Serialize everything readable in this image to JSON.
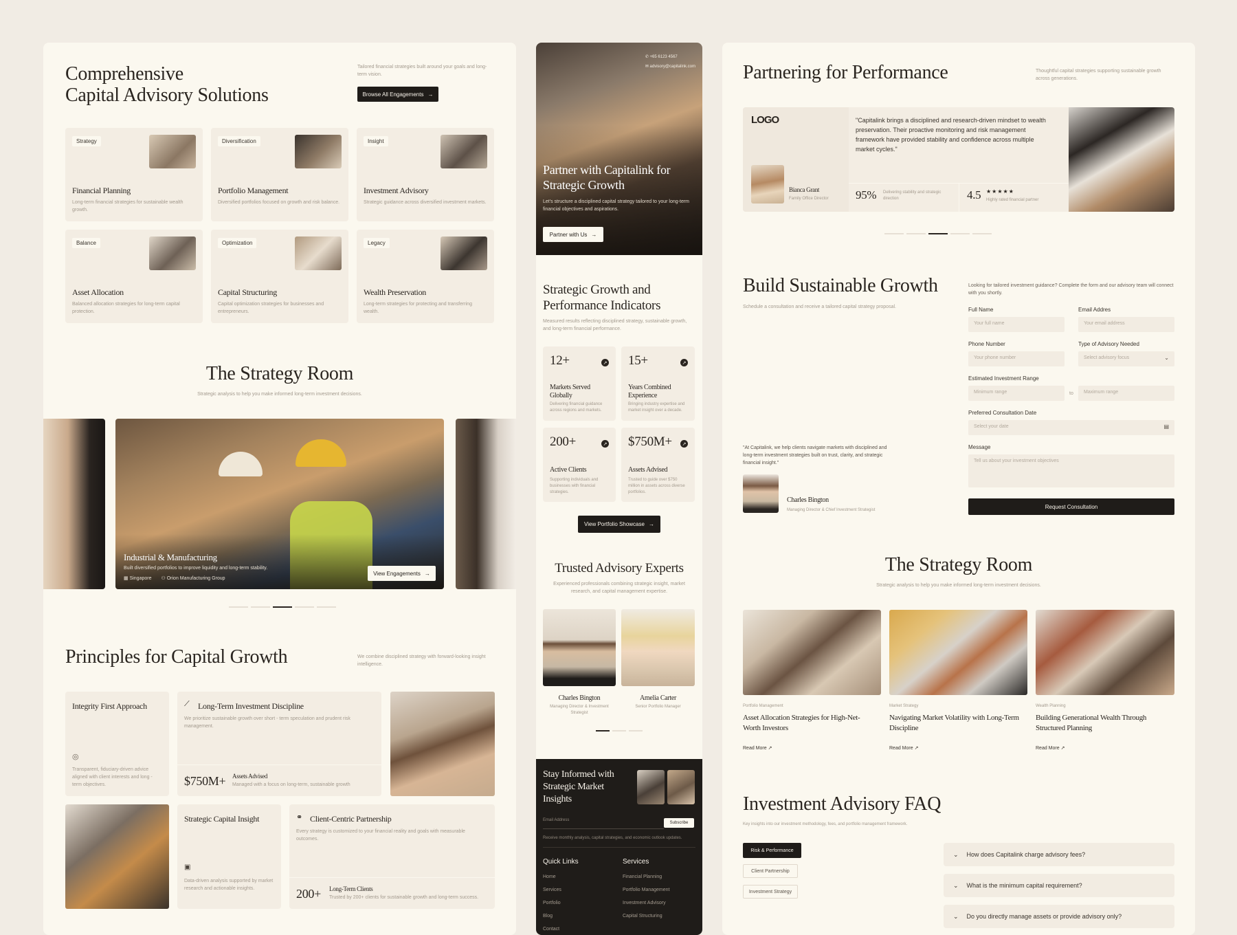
{
  "left": {
    "solutions": {
      "title_line1": "Comprehensive",
      "title_line2": "Capital Advisory Solutions",
      "subtitle": "Tailored financial strategies built around your goals and long-term vision.",
      "browse_button": "Browse All Engagements",
      "cards": [
        {
          "tag": "Strategy",
          "title": "Financial Planning",
          "desc": "Long-term financial strategies for sustainable wealth growth."
        },
        {
          "tag": "Diversification",
          "title": "Portfolio Management",
          "desc": "Diversified portfolios focused on growth and risk balance."
        },
        {
          "tag": "Insight",
          "title": "Investment Advisory",
          "desc": "Strategic guidance across diversified investment markets."
        },
        {
          "tag": "Balance",
          "title": "Asset Allocation",
          "desc": "Balanced allocation strategies for long-term capital protection."
        },
        {
          "tag": "Optimization",
          "title": "Capital Structuring",
          "desc": "Capital optimization strategies for businesses and entrepreneurs."
        },
        {
          "tag": "Legacy",
          "title": "Wealth Preservation",
          "desc": "Long-term strategies for protecting and transferring wealth."
        }
      ]
    },
    "strategy_room": {
      "title": "The Strategy Room",
      "subtitle": "Strategic analysis to help you make informed long-term investment decisions.",
      "slide": {
        "title": "Industrial & Manufacturing",
        "desc": "Built diversified portfolios to improve liquidity and long-term stability.",
        "location": "Singapore",
        "client": "Orion Manufacturing Group",
        "button": "View Engagements"
      }
    },
    "principles": {
      "title": "Principles for Capital Growth",
      "subtitle": "We combine disciplined strategy with forward-looking insight intelligence.",
      "integrity": {
        "title": "Integrity First Approach",
        "desc": "Transparent, fiduciary-driven advice aligned with client interests and long - term objectives."
      },
      "discipline": {
        "title": "Long-Term Investment Discipline",
        "desc": "We prioritize sustainable growth over short - term speculation and prudent risk management.",
        "stat": "$750M+",
        "stat_label": "Assets Advised",
        "stat_desc": "Managed with a focus on long-term, sustainable growth"
      },
      "insight": {
        "title": "Strategic Capital Insight",
        "desc": "Data-driven analysis supported by market research and actionable insights."
      },
      "partnership": {
        "title": "Client-Centric Partnership",
        "desc": "Every strategy is customized to your financial reality and goals with measurable outcomes.",
        "stat": "200+",
        "stat_label": "Long-Term Clients",
        "stat_desc": "Trusted by 200+ clients for sustainable growth and long-term success."
      }
    }
  },
  "middle": {
    "hero": {
      "phone": "+65 6123 4567",
      "email": "advisory@capitalink.com",
      "title_line1": "Partner with Capitalink for",
      "title_line2": "Strategic Growth",
      "desc": "Let's structure a disciplined capital strategy tailored to your long-term financial objectives and aspirations.",
      "button": "Partner with Us"
    },
    "indicators": {
      "title_line1": "Strategic Growth and",
      "title_line2": "Performance Indicators",
      "subtitle": "Measured results reflecting disciplined strategy, sustainable growth, and long-term financial performance.",
      "stats": [
        {
          "value": "12+",
          "label": "Markets Served Globally",
          "desc": "Delivering financial guidance across regions and markets."
        },
        {
          "value": "15+",
          "label": "Years Combined Experience",
          "desc": "Bringing industry expertise and market insight over a decade."
        },
        {
          "value": "200+",
          "label": "Active Clients",
          "desc": "Supporting individuals and businesses with financial strategies."
        },
        {
          "value": "$750M+",
          "label": "Assets Advised",
          "desc": "Trusted to guide over $750 million in assets across diverse portfolios."
        }
      ],
      "button": "View Portfolio Showcase"
    },
    "experts": {
      "title": "Trusted Advisory Experts",
      "subtitle": "Experienced professionals combining strategic insight, market research, and capital management expertise.",
      "people": [
        {
          "name": "Charles Bington",
          "role": "Managing Director & Investment Strategist"
        },
        {
          "name": "Amelia Carter",
          "role": "Senior Portfolio Manager"
        }
      ]
    },
    "newsletter": {
      "title_line1": "Stay Informed with",
      "title_line2": "Strategic Market",
      "title_line3": "Insights",
      "email_placeholder": "Email Address",
      "subscribe": "Subscribe",
      "desc": "Receive monthly analysis, capital strategies, and economic outlook updates."
    },
    "footer": {
      "quick_links_title": "Quick Links",
      "quick_links": [
        "Home",
        "Services",
        "Portfolio",
        "Blog",
        "Contact"
      ],
      "services_title": "Services",
      "services": [
        "Financial Planning",
        "Portfolio Management",
        "Investment Advisory",
        "Capital Structuring"
      ]
    }
  },
  "right": {
    "performance": {
      "title": "Partnering for Performance",
      "subtitle": "Thoughtful capital strategies supporting sustainable growth across generations.",
      "logo": "LOGO",
      "quote": "\"Capitalink brings a disciplined and research-driven mindset to wealth preservation. Their proactive monitoring and risk management framework have provided stability and confidence across multiple market cycles.\"",
      "person_name": "Bianca Grant",
      "person_role": "Family Office Director",
      "stat1_value": "95%",
      "stat1_desc": "Delivering stability and strategic direction",
      "stat2_value": "4.5",
      "stat2_stars": "★★★★★",
      "stat2_desc": "Highly rated financial partner"
    },
    "growth_form": {
      "title": "Build Sustainable Growth",
      "subtitle": "Schedule a consultation and receive a tailored capital strategy proposal.",
      "intro": "Looking for tailored investment guidance? Complete the form and our advisory team will connect with you shortly.",
      "full_name_label": "Full Name",
      "full_name_placeholder": "Your full name",
      "email_label": "Email Addres",
      "email_placeholder": "Your email address",
      "phone_label": "Phone Number",
      "phone_placeholder": "Your phone number",
      "type_label": "Type of Advisory Needed",
      "type_placeholder": "Select advisory focus",
      "range_label": "Estimated Investment Range",
      "min_placeholder": "Minimum range",
      "to_label": "to",
      "max_placeholder": "Maximum range",
      "date_label": "Preferred Consultation Date",
      "date_placeholder": "Select your date",
      "message_label": "Message",
      "message_placeholder": "Tell us about your investment objectives",
      "submit": "Request Consultation",
      "testimonial": "\"At Capitalink, we help clients navigate markets with disciplined and long-term investment strategies built on trust, clarity, and strategic financial insight.\"",
      "person_name": "Charles Bington",
      "person_role": "Managing Director & Chief Investment Strategist"
    },
    "strategy_room": {
      "title": "The Strategy Room",
      "subtitle": "Strategic analysis to help you make informed long-term investment decisions.",
      "articles": [
        {
          "category": "Portfolio Management",
          "title": "Asset Allocation Strategies for High-Net-Worth Investors",
          "link": "Read More"
        },
        {
          "category": "Market Strategy",
          "title": "Navigating Market Volatility with Long-Term Discipline",
          "link": "Read More"
        },
        {
          "category": "Wealth Planning",
          "title": "Building Generational Wealth Through Structured Planning",
          "link": "Read More"
        }
      ]
    },
    "faq": {
      "title": "Investment Advisory FAQ",
      "subtitle": "Key insights into our investment methodology, fees, and portfolio management framework.",
      "categories": [
        "Risk & Performance",
        "Client Partnership",
        "Investment Strategy"
      ],
      "questions": [
        "How does Capitalink charge advisory fees?",
        "What is the minimum capital requirement?",
        "Do you directly manage assets or provide advisory only?"
      ]
    }
  }
}
